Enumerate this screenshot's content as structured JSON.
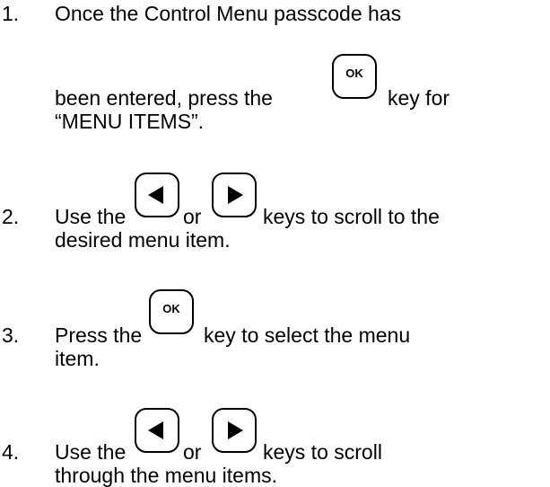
{
  "steps": [
    {
      "number": "1.",
      "line1": "Once the Control Menu passcode has",
      "line2_before": "been entered, press the",
      "line2_key": "OK",
      "line2_after": "key for",
      "line3": "“MENU ITEMS”."
    },
    {
      "number": "2.",
      "line1_before": "Use the",
      "line1_between": "or",
      "line1_after": "keys to scroll to the",
      "line2": "desired menu item."
    },
    {
      "number": "3.",
      "line1_before": "Press the",
      "line1_key": "OK",
      "line1_after": "key to select the menu",
      "line2": "item."
    },
    {
      "number": "4.",
      "line1_before": "Use the",
      "line1_between": "or",
      "line1_after": "keys to scroll",
      "line2": "through the menu items."
    }
  ],
  "icons": {
    "left": "left-arrow-key-icon",
    "right": "right-arrow-key-icon",
    "ok": "ok-key-icon"
  }
}
